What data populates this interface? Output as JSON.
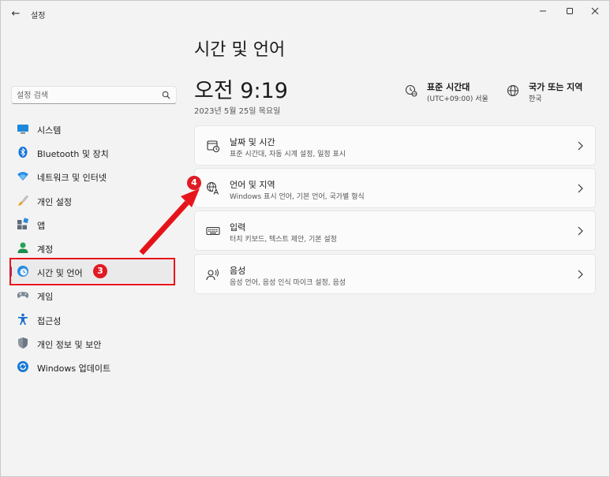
{
  "window": {
    "app_title": "설정",
    "back_glyph": "←",
    "minimize_glyph": "—",
    "maximize_glyph": "☐",
    "close_glyph": "✕"
  },
  "sidebar": {
    "search": {
      "placeholder": "설정 검색"
    },
    "items": [
      {
        "label": "시스템",
        "icon": "monitor-icon"
      },
      {
        "label": "Bluetooth 및 장치",
        "icon": "bluetooth-icon"
      },
      {
        "label": "네트워크 및 인터넷",
        "icon": "wifi-icon"
      },
      {
        "label": "개인 설정",
        "icon": "brush-icon"
      },
      {
        "label": "앱",
        "icon": "apps-icon"
      },
      {
        "label": "계정",
        "icon": "account-icon"
      },
      {
        "label": "시간 및 언어",
        "icon": "clock-globe-icon",
        "active": true
      },
      {
        "label": "게임",
        "icon": "gamepad-icon"
      },
      {
        "label": "접근성",
        "icon": "accessibility-icon"
      },
      {
        "label": "개인 정보 및 보안",
        "icon": "shield-icon"
      },
      {
        "label": "Windows 업데이트",
        "icon": "update-icon"
      }
    ]
  },
  "annotations": {
    "step3": "3",
    "step4": "4",
    "color": "#e01a22"
  },
  "main": {
    "title": "시간 및 언어",
    "clock": "오전 9:19",
    "date": "2023년 5월 25일 목요일",
    "timezone": {
      "title": "표준 시간대",
      "value": "(UTC+09:00) 서울"
    },
    "region": {
      "title": "국가 또는 지역",
      "value": "한국"
    },
    "cards": [
      {
        "title": "날짜 및 시간",
        "subtitle": "표준 시간대, 자동 시계 설정, 일정 표시",
        "icon": "calendar-clock-icon"
      },
      {
        "title": "언어 및 지역",
        "subtitle": "Windows 표시 언어, 기본 언어, 국가별 형식",
        "icon": "language-icon"
      },
      {
        "title": "입력",
        "subtitle": "터치 키보드, 텍스트 제안, 기본 설정",
        "icon": "keyboard-icon"
      },
      {
        "title": "음성",
        "subtitle": "음성 언어, 음성 인식 마이크 설정, 음성",
        "icon": "speech-icon"
      }
    ]
  },
  "colors": {
    "accent": "#7b2f9e",
    "highlight": "#e8141b",
    "background": "#f3f3f3"
  }
}
